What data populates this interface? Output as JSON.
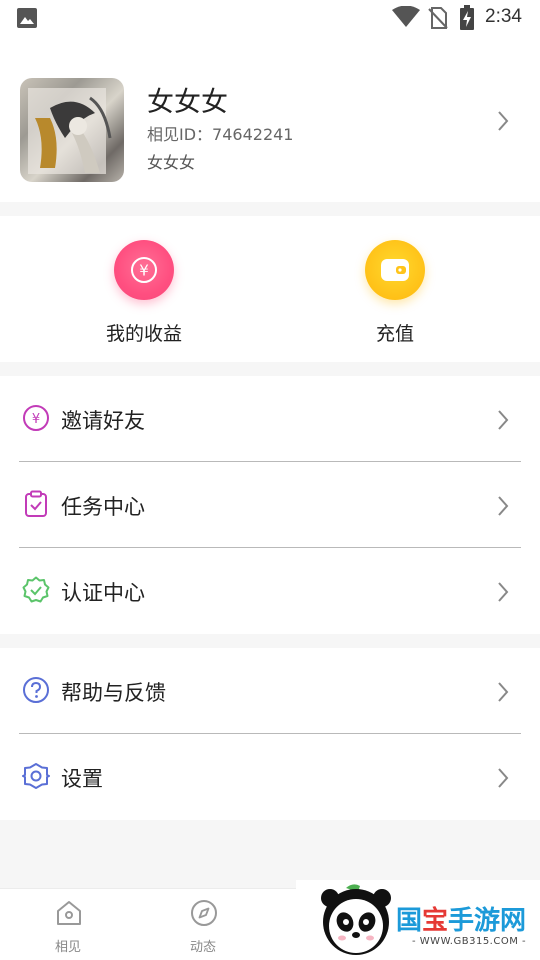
{
  "status_bar": {
    "time": "2:34"
  },
  "profile": {
    "nickname": "女女女",
    "user_id": "相见ID：74642241",
    "signature": "女女女"
  },
  "wallet": {
    "earnings_label": "我的收益",
    "earnings_symbol": "¥",
    "recharge_label": "充值"
  },
  "menu": {
    "group1": [
      {
        "label": "邀请好友",
        "icon": "yen-circle-icon"
      },
      {
        "label": "任务中心",
        "icon": "clipboard-check-icon"
      },
      {
        "label": "认证中心",
        "icon": "verified-badge-icon"
      }
    ],
    "group2": [
      {
        "label": "帮助与反馈",
        "icon": "help-circle-icon"
      },
      {
        "label": "设置",
        "icon": "gear-icon"
      }
    ]
  },
  "tabbar": {
    "home_label": "相见",
    "moments_label": "动态"
  },
  "watermark": {
    "title_part1": "国",
    "title_part2": "宝",
    "title_part3": "手游网",
    "url": "- WWW.GB315.COM -"
  },
  "colors": {
    "earnings_pink": "#ff4f80",
    "recharge_yellow": "#ffc41a",
    "invite_icon": "#c23bb8",
    "task_icon": "#c23bb8",
    "verify_icon": "#5bc46a",
    "help_icon": "#5a6fd6",
    "settings_icon": "#5a6fd6"
  }
}
